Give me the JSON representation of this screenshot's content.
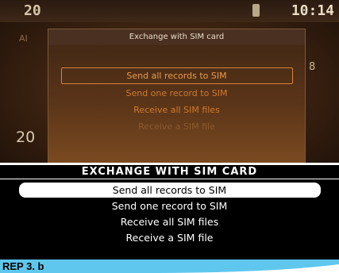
{
  "photo_display": {
    "status_left": "20",
    "status_time": "10:14",
    "background_left_label": "AI",
    "background_left_number": "20",
    "background_right_mark": "8",
    "menu_title": "Exchange with SIM card",
    "menu_items": [
      {
        "label": "Send all records to SIM",
        "state": "selected"
      },
      {
        "label": "Send one record to SIM",
        "state": "normal"
      },
      {
        "label": "Receive all SIM files",
        "state": "normal"
      },
      {
        "label": "Receive a SIM file",
        "state": "faded"
      }
    ]
  },
  "mono_display": {
    "title": "EXCHANGE WITH SIM CARD",
    "menu_items": [
      {
        "label": "Send all records to SIM",
        "state": "selected"
      },
      {
        "label": "Send one record to SIM",
        "state": "normal"
      },
      {
        "label": "Receive all SIM files",
        "state": "normal"
      },
      {
        "label": "Receive a SIM file",
        "state": "normal"
      }
    ]
  },
  "reference_label": "REP 3. b",
  "colors": {
    "accent_orange": "#d07a2c",
    "band_blue": "#5fc7ee"
  }
}
